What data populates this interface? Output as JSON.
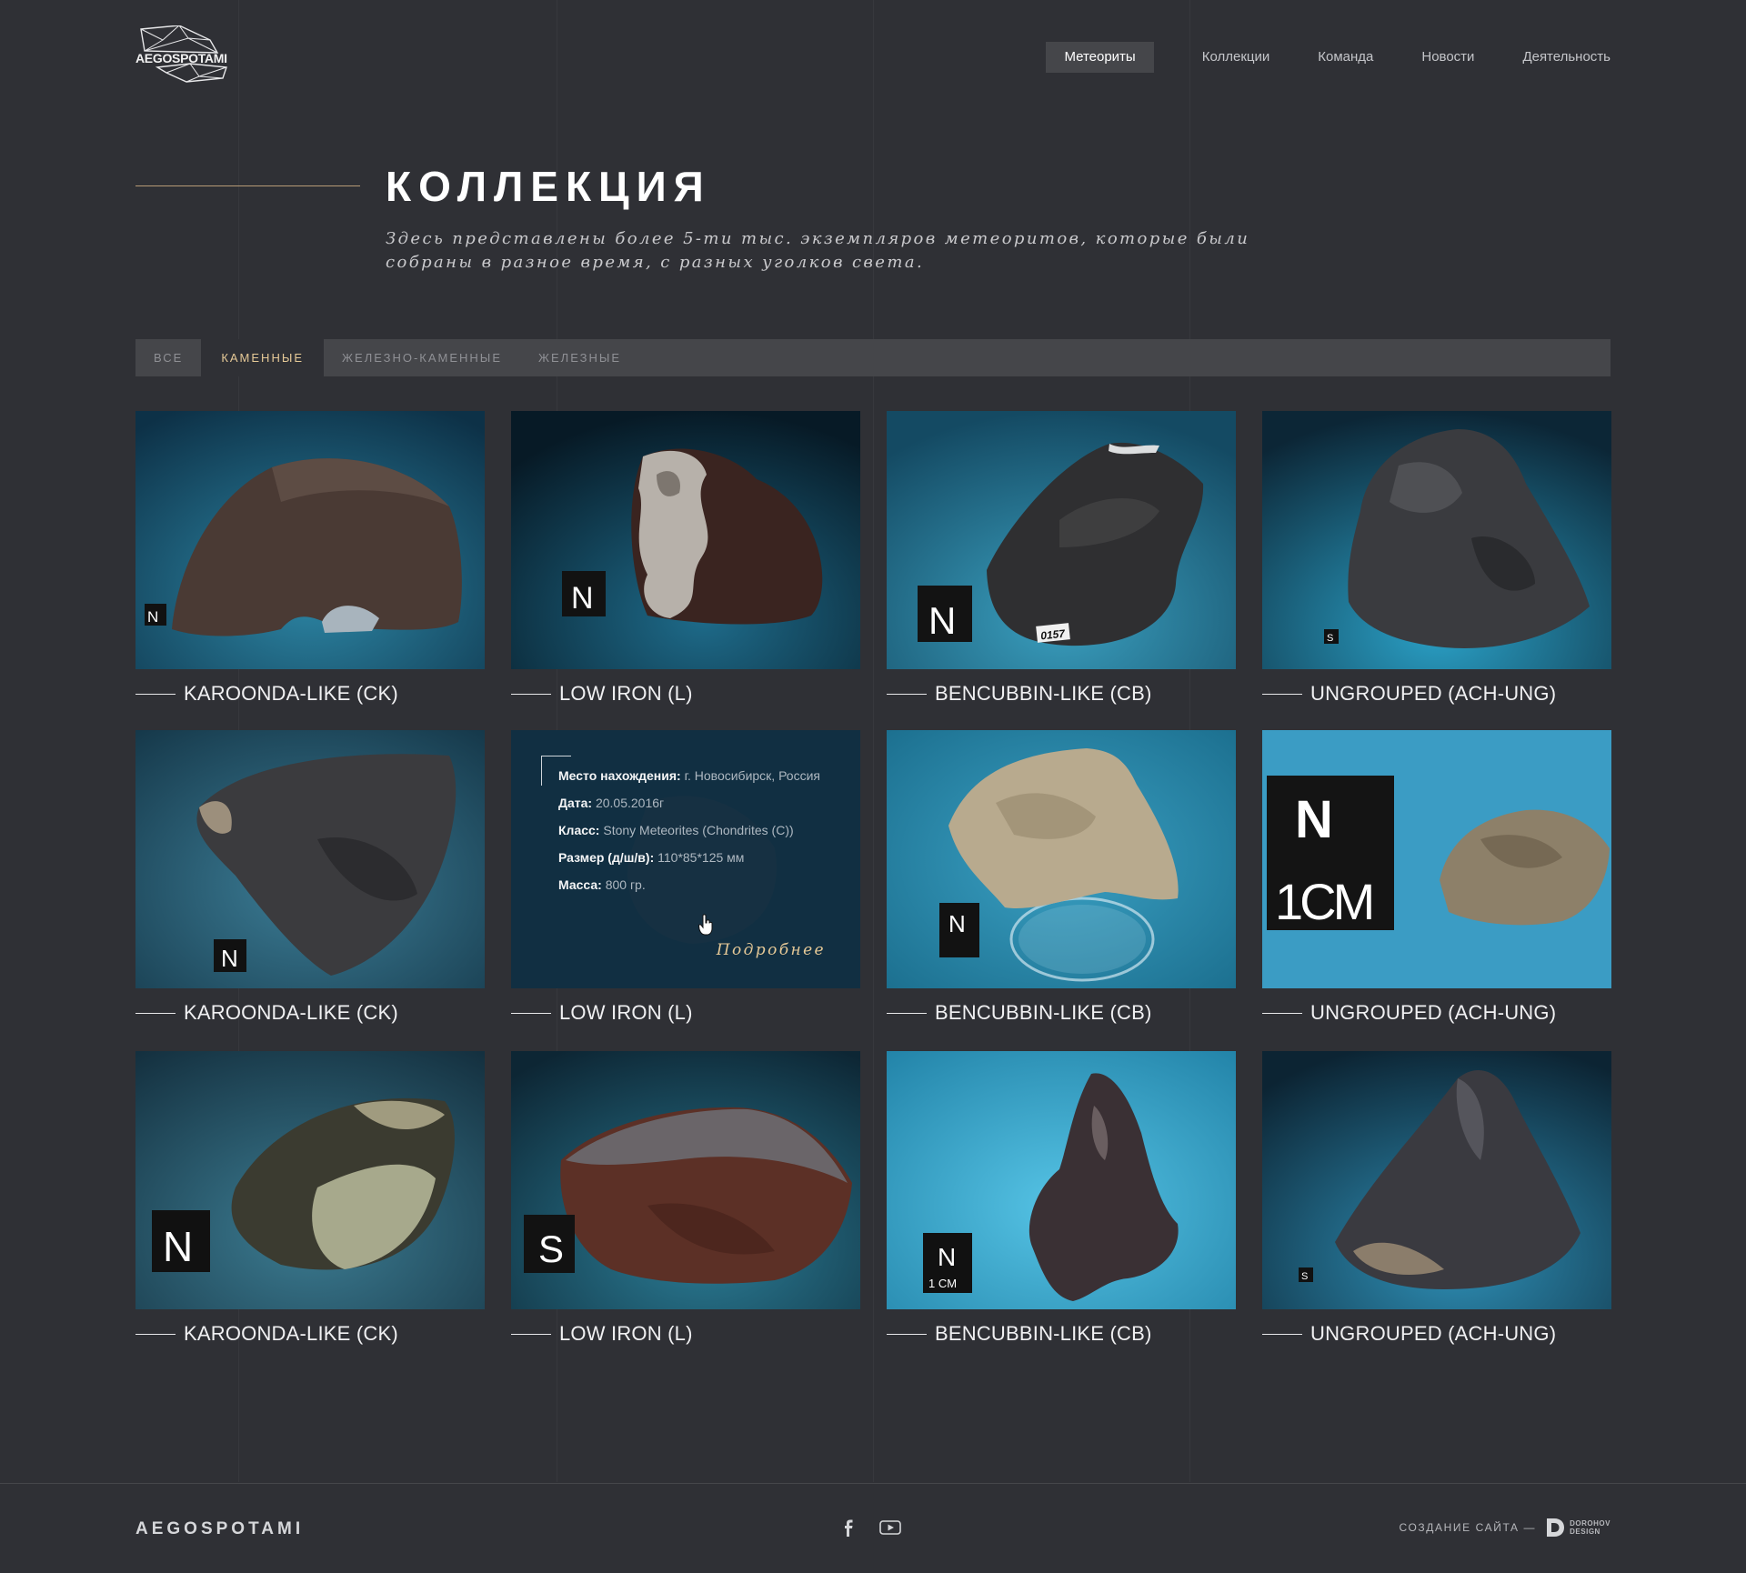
{
  "header": {
    "logo_text": "AEGOSPOTAMI",
    "nav": [
      {
        "label": "Метеориты",
        "active": true
      },
      {
        "label": "Коллекции"
      },
      {
        "label": "Команда"
      },
      {
        "label": "Новости"
      },
      {
        "label": "Деятельность"
      }
    ]
  },
  "hero": {
    "title": "КОЛЛЕКЦИЯ",
    "subtitle": "Здесь представлены более 5-ти тыс. экземпляров метеоритов, которые были собраны в разное время, с разных уголков света."
  },
  "tabs": [
    {
      "label": "ВСЕ"
    },
    {
      "label": "КАМЕННЫЕ",
      "active": true
    },
    {
      "label": "ЖЕЛЕЗНО-КАМЕННЫЕ"
    },
    {
      "label": "ЖЕЛЕЗНЫЕ"
    }
  ],
  "colors": {
    "background": "#2f3035",
    "accent_gold": "#e6c997",
    "title_line": "#b69b76",
    "tab_bar": "#45464a"
  },
  "cards": [
    {
      "title": "KAROONDA-LIKE (CK)",
      "cube_label": "N"
    },
    {
      "title": "LOW IRON (L)",
      "cube_label": "N"
    },
    {
      "title": "BENCUBBIN-LIKE (CB)",
      "cube_label": "N",
      "tag": "0157"
    },
    {
      "title": "UNGROUPED (ACH-UNG)",
      "cube_label": "S"
    },
    {
      "title": "KAROONDA-LIKE (CK)",
      "cube_label": "N"
    },
    {
      "title": "LOW IRON (L)",
      "hover": true
    },
    {
      "title": "BENCUBBIN-LIKE (CB)",
      "cube_label": "N"
    },
    {
      "title": "UNGROUPED (ACH-UNG)",
      "cube_label": "N",
      "cube_sub": "1CM"
    },
    {
      "title": "KAROONDA-LIKE (CK)",
      "cube_label": "N"
    },
    {
      "title": "LOW IRON (L)",
      "cube_label": "S"
    },
    {
      "title": "BENCUBBIN-LIKE (CB)",
      "cube_label": "N",
      "cube_sub": "1 CM"
    },
    {
      "title": "UNGROUPED (ACH-UNG)",
      "cube_label": "S"
    }
  ],
  "hover_info": {
    "location_label": "Место нахождения:",
    "location_value": " г. Новосибирск, Россия",
    "date_label": "Дата:",
    "date_value": " 20.05.2016г",
    "class_label": "Класс:",
    "class_value": " Stony Meteorites (Chondrites (C))",
    "size_label": "Размер (д/ш/в):",
    "size_value": " 110*85*125 мм",
    "mass_label": "Масса:",
    "mass_value": " 800 гр.",
    "more_label": "Подробнее"
  },
  "footer": {
    "brand": "AEGOSPOTAMI",
    "social": [
      "facebook-icon",
      "youtube-icon"
    ],
    "credit_text": "СОЗДАНИЕ САЙТА —",
    "credit_line1": "DOROHOV",
    "credit_line2": "DESIGN"
  }
}
